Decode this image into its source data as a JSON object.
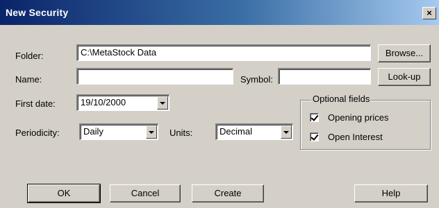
{
  "dialog": {
    "title": "New Security"
  },
  "folder": {
    "label": "Folder:",
    "value": "C:\\MetaStock Data",
    "browse_label": "Browse..."
  },
  "name": {
    "label": "Name:",
    "value": ""
  },
  "symbol": {
    "label": "Symbol:",
    "value": "",
    "lookup_label": "Look-up"
  },
  "first_date": {
    "label": "First date:",
    "value": "19/10/2000"
  },
  "periodicity": {
    "label": "Periodicity:",
    "value": "Daily"
  },
  "units": {
    "label": "Units:",
    "value": "Decimal"
  },
  "optional_fields": {
    "label": "Optional fields",
    "opening_prices": {
      "label": "Opening prices",
      "checked": true
    },
    "open_interest": {
      "label": "Open Interest",
      "checked": true
    }
  },
  "buttons": {
    "ok": "OK",
    "cancel": "Cancel",
    "create": "Create",
    "help": "Help"
  }
}
